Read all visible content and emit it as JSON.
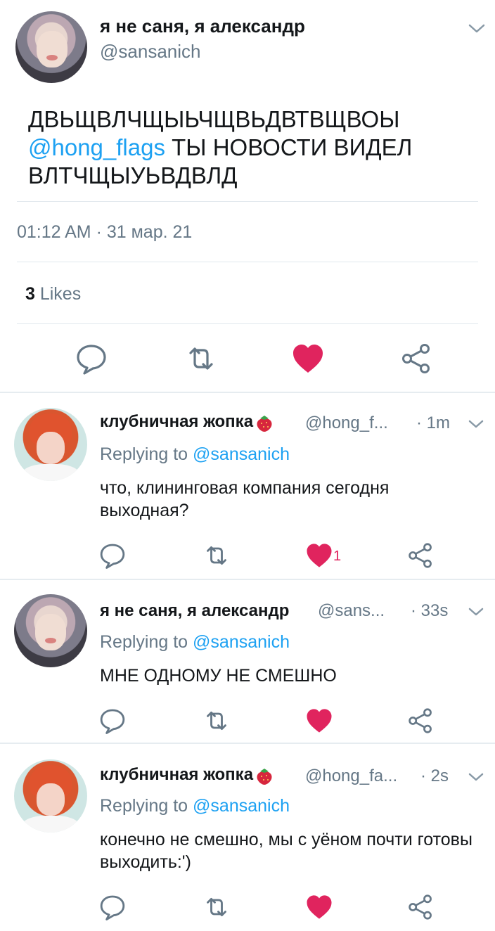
{
  "main_tweet": {
    "display_name": "я не саня, я александр",
    "handle": "@sansanich",
    "text_line1": "ДВЬЩВЛЧЩЫЬЧЩВЬДВТВЩВОЫ",
    "text_mention": "@hong_flags",
    "text_line2_rest": " ТЫ НОВОСТИ ВИДЕЛ",
    "text_line3": "ВЛТЧЩЫУЬВДВЛД",
    "timestamp": "01:12 AM · 31 мар. 21",
    "likes_count": "3",
    "likes_label": " Likes",
    "liked": true
  },
  "replies": [
    {
      "display_name": "клубничная жопка",
      "emoji": "strawberry-icon",
      "handle": "@hong_f...",
      "time": "· 1m",
      "replying_prefix": "Replying to ",
      "replying_to": "@sansanich",
      "text": "что, клининговая компания сегодня выходная?",
      "like_count": "1",
      "liked": true,
      "avatar": "red-hair"
    },
    {
      "display_name": "я не саня, я александр",
      "emoji": "",
      "handle": "@sans...",
      "time": "· 33s",
      "replying_prefix": "Replying to ",
      "replying_to": "@sansanich",
      "text": "МНЕ ОДНОМУ НЕ СМЕШНО",
      "like_count": "",
      "liked": true,
      "avatar": "gray-hair"
    },
    {
      "display_name": "клубничная жопка",
      "emoji": "strawberry-icon",
      "handle": "@hong_fa...",
      "time": "· 2s",
      "replying_prefix": "Replying to ",
      "replying_to": "@sansanich",
      "text": "конечно не смешно, мы с уёном почти готовы выходить:')",
      "like_count": "",
      "liked": true,
      "avatar": "red-hair"
    }
  ],
  "colors": {
    "accent": "#1da1f2",
    "like": "#e0245e",
    "secondary_text": "#657786",
    "icon_gray": "#657786"
  }
}
